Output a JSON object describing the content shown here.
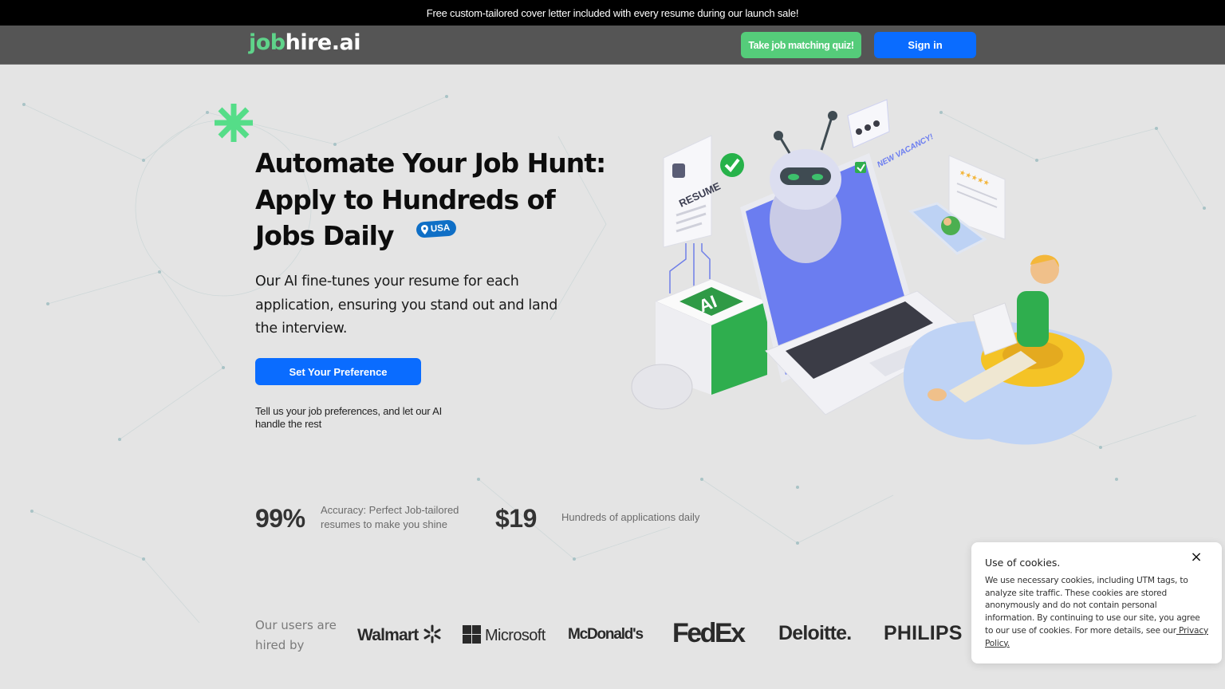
{
  "announcement": "Free custom-tailored cover letter included with every resume during our launch sale!",
  "header": {
    "logo_accent": "job",
    "logo_rest": "hire.ai",
    "quiz_button": "Take job matching quiz!",
    "signin_button": "Sign in"
  },
  "hero": {
    "title_line1": "Automate Your Job Hunt:",
    "title_line2": "Apply to Hundreds of",
    "title_line3": "Jobs Daily",
    "location_badge": "USA",
    "subtitle": "Our AI fine-tunes your resume for each application, ensuring you stand out and land the interview.",
    "cta_button": "Set Your Preference",
    "cta_note": "Tell us your job preferences, and let our AI handle the rest"
  },
  "illustration": {
    "resume_label": "RESUME",
    "vacancy_label": "NEW VACANCY!",
    "chip_label": "AI"
  },
  "stats": [
    {
      "value": "99%",
      "description": "Accuracy: Perfect Job-tailored resumes to make you shine"
    },
    {
      "value": "$19",
      "description": "Hundreds of applications daily"
    }
  ],
  "hired_by": {
    "label": "Our users are hired by",
    "brands": [
      "Walmart",
      "Microsoft",
      "McDonald's",
      "FedEx",
      "Deloitte.",
      "PHILIPS"
    ]
  },
  "cookie_notice": {
    "title": "Use of cookies.",
    "body": "We use necessary cookies, including UTM tags, to analyze site traffic. These cookies are stored anonymously and do not contain personal information. By continuing to use our site, you agree to our use of cookies. For more details, see our",
    "link_text": " Privacy Policy.",
    "close_label": "×"
  },
  "colors": {
    "brand_green": "#5fd38a",
    "primary_blue": "#0a6cff",
    "header_gray": "#555555",
    "badge_blue": "#0f6fc6"
  }
}
